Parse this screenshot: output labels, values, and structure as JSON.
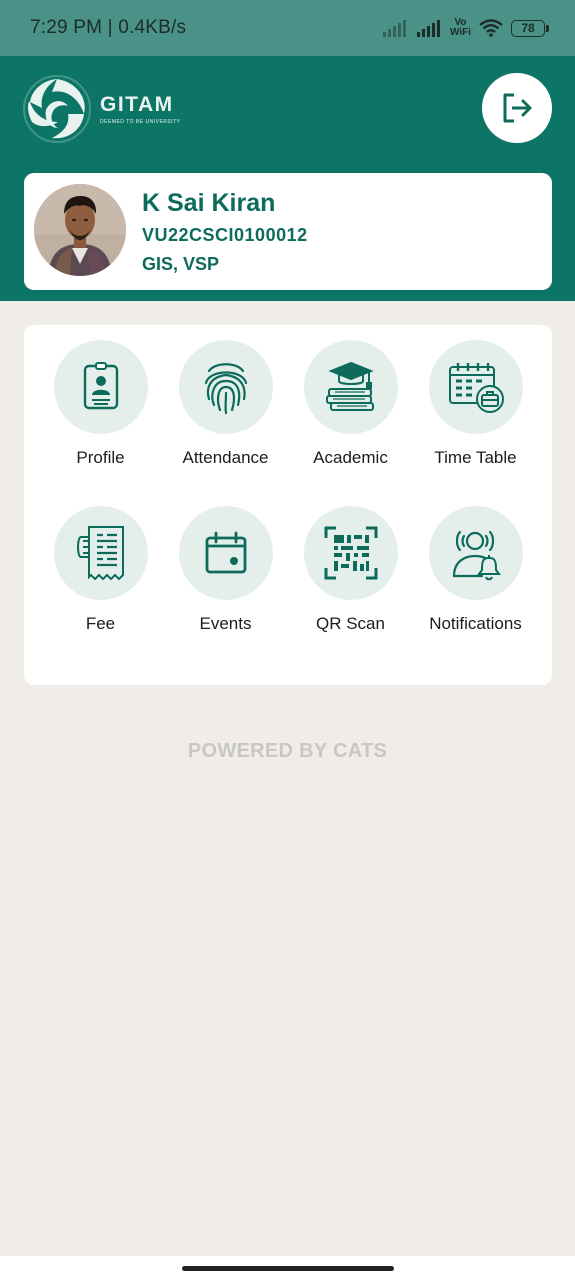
{
  "status_bar": {
    "time_speed": "7:29 PM | 0.4KB/s",
    "vowifi_top": "Vo",
    "vowifi_bottom": "WiFi",
    "battery": "78"
  },
  "header": {
    "logo_title": "GITAM",
    "logo_subtitle": "DEEMED TO BE UNIVERSITY",
    "logout_icon": "logout-icon",
    "brand_color": "#0d7565"
  },
  "profile": {
    "name": "K Sai Kiran",
    "id": "VU22CSCI0100012",
    "campus": "GIS, VSP"
  },
  "menu": {
    "items": [
      {
        "label": "Profile",
        "icon": "id-badge-icon"
      },
      {
        "label": "Attendance",
        "icon": "fingerprint-icon"
      },
      {
        "label": "Academic",
        "icon": "graduation-books-icon"
      },
      {
        "label": "Time Table",
        "icon": "calendar-briefcase-icon"
      },
      {
        "label": "Fee",
        "icon": "receipt-icon"
      },
      {
        "label": "Events",
        "icon": "calendar-icon"
      },
      {
        "label": "QR Scan",
        "icon": "qr-code-icon"
      },
      {
        "label": "Notifications",
        "icon": "user-bell-icon"
      }
    ]
  },
  "footer": {
    "powered_by": "POWERED BY CATS"
  }
}
